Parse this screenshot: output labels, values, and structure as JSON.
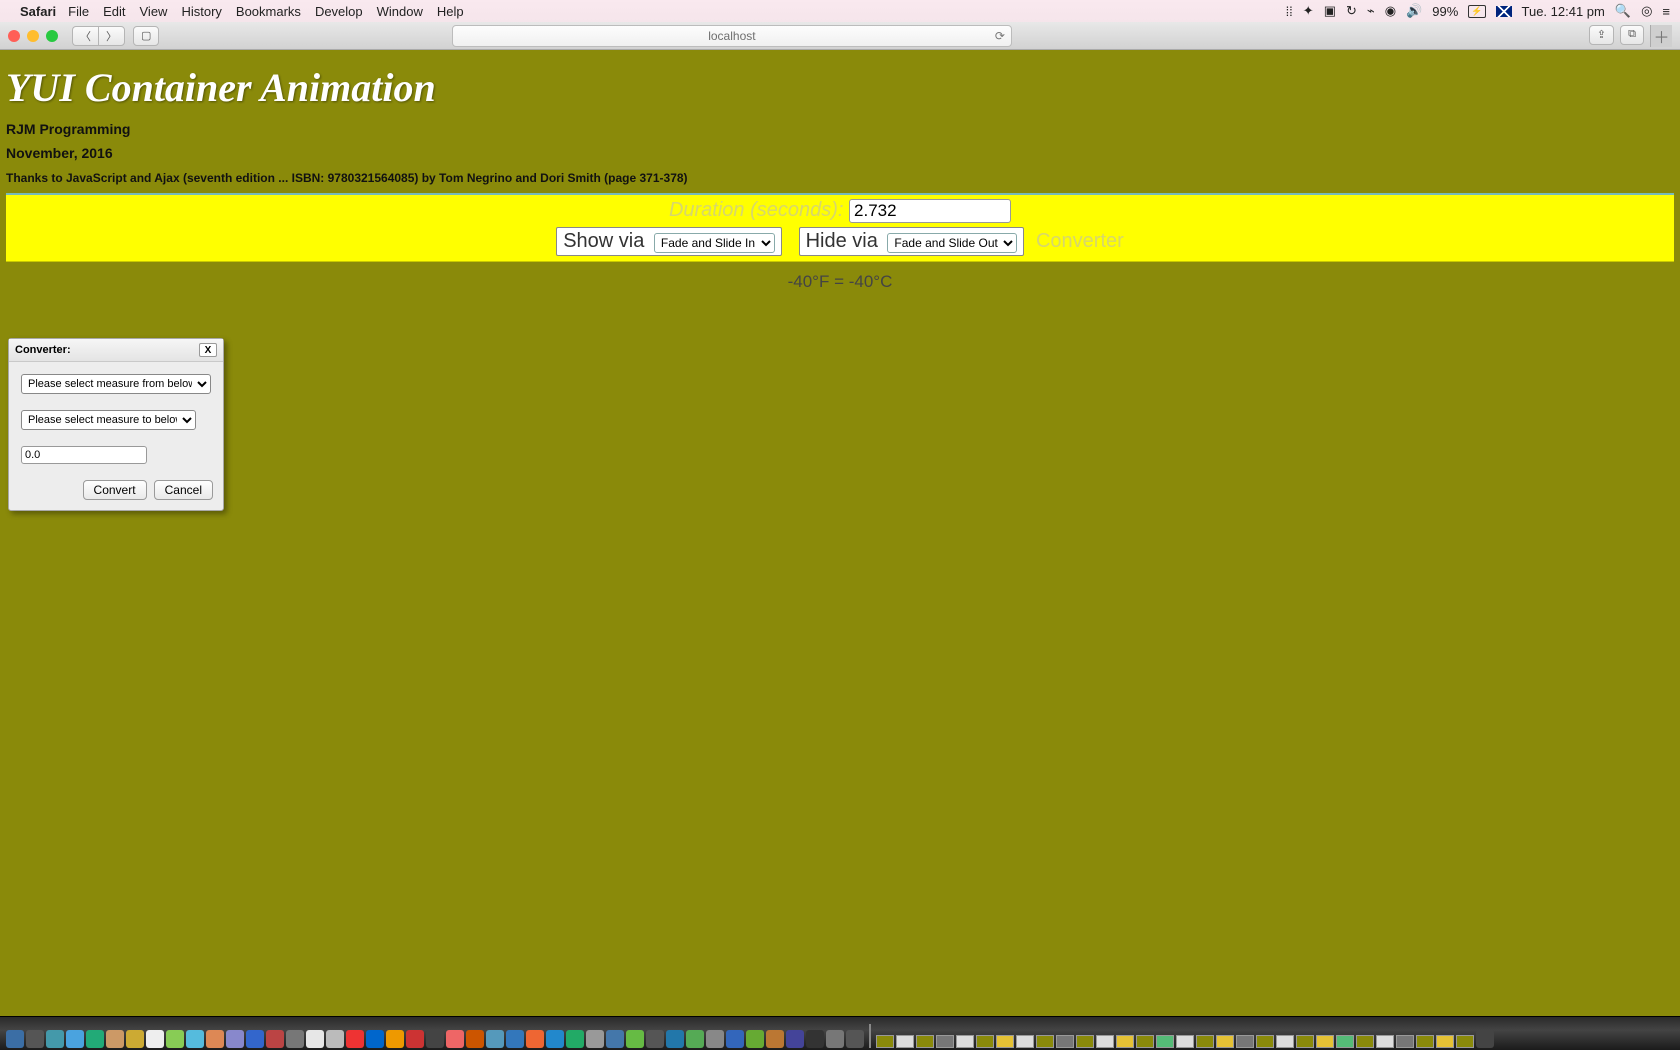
{
  "menubar": {
    "app": "Safari",
    "items": [
      "File",
      "Edit",
      "View",
      "History",
      "Bookmarks",
      "Develop",
      "Window",
      "Help"
    ],
    "battery": "99%",
    "clock": "Tue. 12:41 pm"
  },
  "browser": {
    "address": "localhost"
  },
  "page": {
    "title": "YUI Container Animation",
    "org": "RJM Programming",
    "date": "November, 2016",
    "thanks": "Thanks to JavaScript and Ajax (seventh edition ... ISBN: 9780321564085) by Tom Negrino and Dori Smith (page 371-378)"
  },
  "controls": {
    "duration_label": "Duration (seconds):",
    "duration_value": "2.732",
    "show_label": "Show via",
    "show_option": "Fade and Slide In",
    "hide_label": "Hide via",
    "hide_option": "Fade and Slide Out",
    "converter_label": "Converter"
  },
  "result": "-40°F = -40°C",
  "converter": {
    "title": "Converter:",
    "close": "X",
    "from_placeholder": "Please select measure from below ...",
    "to_placeholder": "Please select measure to below ...",
    "value": "0.0",
    "convert": "Convert",
    "cancel": "Cancel"
  }
}
